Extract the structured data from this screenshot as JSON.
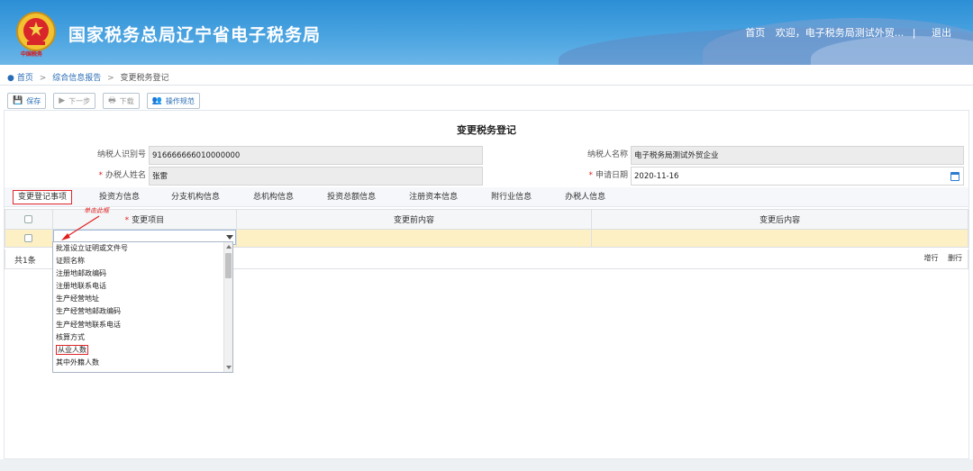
{
  "header": {
    "site_title": "国家税务总局辽宁省电子税务局",
    "emblem_caption": "中国税务",
    "nav_home": "首页",
    "nav_welcome": "欢迎，电子税务局测试外贸...",
    "nav_sep": "|",
    "nav_logout": "退出"
  },
  "breadcrumb": {
    "items": [
      "首页",
      "综合信息报告",
      "变更税务登记"
    ],
    "arrow": ">"
  },
  "toolbar": {
    "save": "保存",
    "next": "下一步",
    "download": "下载",
    "guide": "操作规范"
  },
  "form": {
    "title": "变更税务登记",
    "taxpayer_id_label": "纳税人识别号",
    "taxpayer_id_value": "916666666010000000",
    "taxpayer_name_label": "纳税人名称",
    "taxpayer_name_value": "电子税务局测试外贸企业",
    "handler_label": "办税人姓名",
    "handler_value": "张雷",
    "apply_date_label": "申请日期",
    "apply_date_value": "2020-11-16",
    "required_mark": "*"
  },
  "tabs": [
    "变更登记事项",
    "投资方信息",
    "分支机构信息",
    "总机构信息",
    "投资总额信息",
    "注册资本信息",
    "附行业信息",
    "办税人信息"
  ],
  "table": {
    "col_item": "变更项目",
    "col_before": "变更前内容",
    "col_after": "变更后内容",
    "count": "共1条",
    "add_row": "增行",
    "del_row": "删行"
  },
  "dropdown": {
    "items": [
      "批准设立证明或文件号",
      "证照名称",
      "注册地邮政编码",
      "注册地联系电话",
      "生产经营地址",
      "生产经营地邮政编码",
      "生产经营地联系电话",
      "核算方式",
      "从业人数",
      "其中外籍人数"
    ],
    "highlighted_index": 8
  },
  "annotation": {
    "text": "单击此框"
  },
  "colors": {
    "header_blue": "#2c8fd6",
    "link_blue": "#2b6db5",
    "highlight_red": "#e0262b",
    "row_yellow": "#fdf0c5"
  }
}
